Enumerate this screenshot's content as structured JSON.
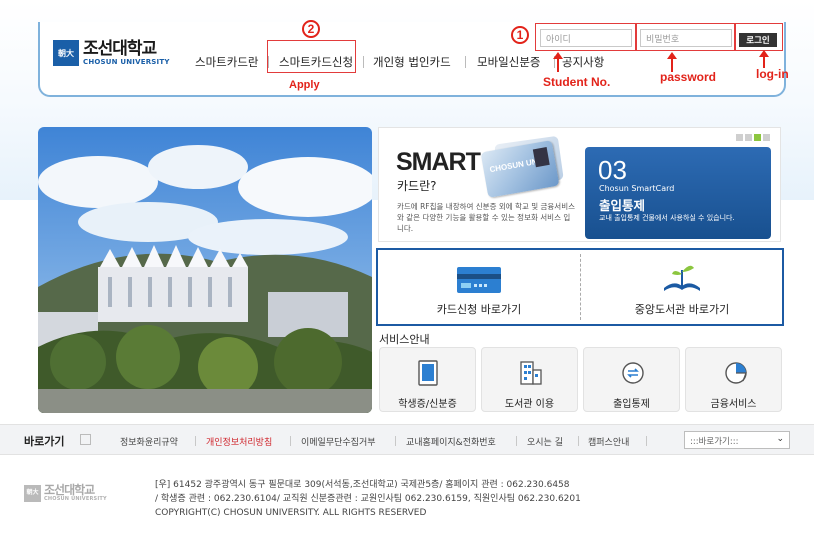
{
  "brand": {
    "logo_mark": "朝大",
    "name_ko": "조선대학교",
    "name_en": "CHOSUN UNIVERSITY"
  },
  "nav": {
    "items": [
      {
        "label": "스마트카드란"
      },
      {
        "label": "스마트카드신청"
      },
      {
        "label": "개인형 법인카드"
      },
      {
        "label": "모바일신분증"
      },
      {
        "label": "공지사항"
      }
    ]
  },
  "login": {
    "id_placeholder": "아이디",
    "password_placeholder": "비밀번호",
    "button_label": "로그인"
  },
  "annotations": {
    "circle1": "1",
    "circle2": "2",
    "apply": "Apply",
    "student_no": "Student No.",
    "password": "password",
    "login": "log-in"
  },
  "smart": {
    "title": "SMART",
    "subtitle": "카드란?",
    "desc": "카드에 RF칩을 내장하여 신분증 외에 학교 및 금융서비스와 같은 다양한 기능을 활용할 수 있는 정보화 서비스 입니다.",
    "card_text": "CHOSUN UNIV",
    "slide": {
      "number": "03",
      "subtitle": "Chosun SmartCard",
      "title": "출입통제",
      "desc": "교내 출입통제 건물에서 사용하실 수 있습니다."
    }
  },
  "quick": {
    "card_apply": "카드신청 바로가기",
    "library": "중앙도서관 바로가기"
  },
  "services": {
    "title": "서비스안내",
    "items": [
      {
        "label": "학생증/신분증"
      },
      {
        "label": "도서관 이용"
      },
      {
        "label": "출입통제"
      },
      {
        "label": "금융서비스"
      }
    ]
  },
  "shortcuts": {
    "title": "바로가기",
    "links": [
      {
        "label": "정보화윤리규약"
      },
      {
        "label": "개인정보처리방침"
      },
      {
        "label": "이메일무단수집거부"
      },
      {
        "label": "교내홈페이지&전화번호"
      },
      {
        "label": "오시는 길"
      },
      {
        "label": "캠퍼스안내"
      }
    ],
    "select_value": ":::바로가기:::"
  },
  "footer": {
    "line1": "[우] 61452 광주광역시 동구 필문대로 309(서석동,조선대학교) 국제관5층/ 홈페이지 관련 : 062.230.6458",
    "line2": "/ 학생증 관련 : 062.230.6104/ 교직원 신분증관련 : 교원인사팀 062.230.6159, 직원인사팀 062.230.6201",
    "line3": "COPYRIGHT(C) CHOSUN UNIVERSITY. ALL RIGHTS RESERVED"
  },
  "colors": {
    "accent_blue": "#1c5aa3",
    "annotation_red": "#e2231a",
    "highlight_green": "#8cc63f"
  }
}
